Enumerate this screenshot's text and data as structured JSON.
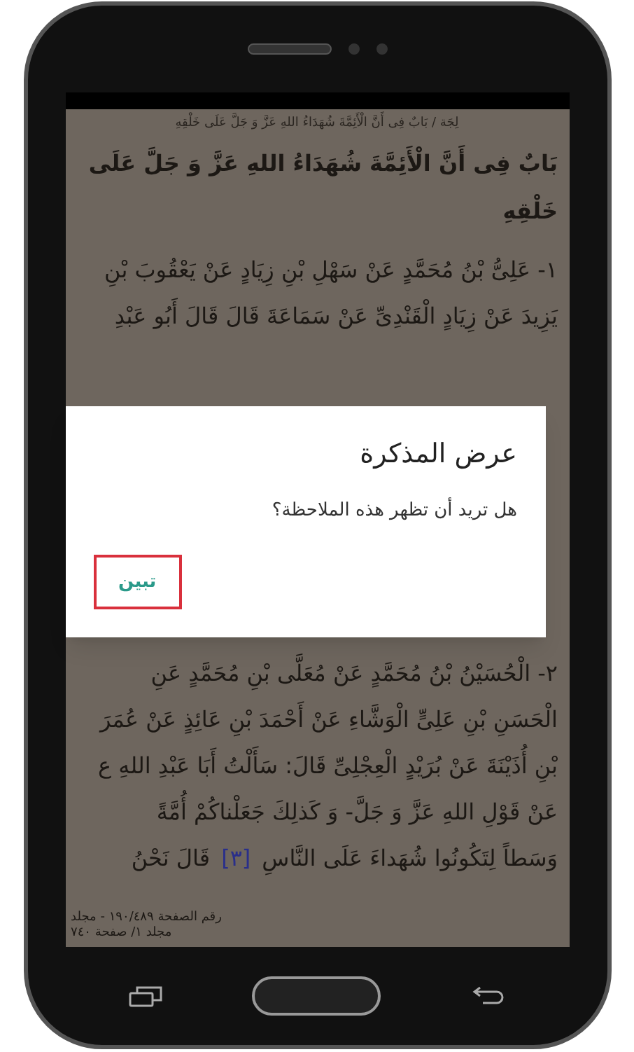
{
  "breadcrumb": "لِجَة / بَابٌ فِی أَنَّ الْأَئِمَّةَ شُهَدَاءُ اللهِ عَزَّ وَ جَلَّ عَلَى خَلْقِهِ",
  "heading": [
    "بَابٌ فِی أَنَّ الْأَئِمَّةَ شُهَدَاءُ اللهِ عَزَّ وَ جَلَّ عَلَى",
    "خَلْقِهِ"
  ],
  "hadith_1": [
    [
      {
        "kind": "plain",
        "text": "١- عَلِیُّ بْنُ مُحَمَّدٍ عَنْ سَهْلِ بْنِ زِيَادٍ عَنْ يَعْقُوبَ بْنِ"
      }
    ],
    [
      {
        "kind": "plain",
        "text": "يَزِيدَ عَنْ زِيَادٍ الْقَنْدِیِّ عَنْ سَمَاعَةَ قَالَ قَالَ أَبُو عَبْدِ"
      }
    ]
  ],
  "hadith_2": [
    [
      {
        "kind": "plain",
        "text": "٢- الْحُسَيْنُ بْنُ مُحَمَّدٍ عَنْ مُعَلَّى بْنِ مُحَمَّدٍ عَنِ"
      }
    ],
    [
      {
        "kind": "plain",
        "text": "الْحَسَنِ بْنِ عَلِیٍّ الْوَشَّاءِ عَنْ أَحْمَدَ بْنِ عَائِذٍ عَنْ عُمَرَ"
      }
    ],
    [
      {
        "kind": "plain",
        "text": "بْنِ أُذَيْنَةَ عَنْ بُرَيْدٍ الْعِجْلِیِّ قَالَ: سَأَلْتُ أَبَا عَبْدِ اللهِ ع"
      }
    ],
    [
      {
        "kind": "plain",
        "text": "عَنْ قَوْلِ اللهِ عَزَّ وَ جَلَّ- وَ كَذلِكَ جَعَلْناكُمْ أُمَّةً"
      }
    ],
    [
      {
        "kind": "plain",
        "text": "وَسَطاً لِتَكُونُوا شُهَداءَ عَلَى النَّاسِ"
      },
      {
        "kind": "footnote",
        "text": "[٣]"
      },
      {
        "kind": "plain",
        "text": "قَالَ نَحْنُ"
      }
    ]
  ],
  "footer": [
    "رقم الصفحة ١٩٠/٤٨٩ - مجلد",
    "مجلد ١/ صفحة ٧٤٠"
  ],
  "dialog": {
    "title": "عرض المذكرة",
    "message": "هل تريد أن تظهر هذه الملاحظة؟",
    "button": {
      "label": "تبين",
      "highlighted": true
    }
  }
}
